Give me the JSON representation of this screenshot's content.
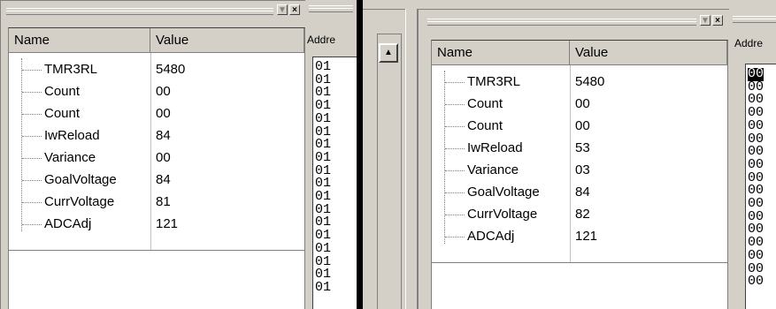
{
  "left": {
    "columns": {
      "name": "Name",
      "value": "Value"
    },
    "rows": [
      {
        "name": "TMR3RL",
        "value": "5480"
      },
      {
        "name": "Count",
        "value": "00"
      },
      {
        "name": "Count",
        "value": "00"
      },
      {
        "name": "IwReload",
        "value": "84"
      },
      {
        "name": "Variance",
        "value": "00"
      },
      {
        "name": "GoalVoltage",
        "value": "84"
      },
      {
        "name": "CurrVoltage",
        "value": "81"
      },
      {
        "name": "ADCAdj",
        "value": "121"
      }
    ],
    "address_header": "Addre",
    "address_lines": [
      "01",
      "01",
      "01",
      "01",
      "01",
      "01",
      "01",
      "01",
      "01",
      "01",
      "01",
      "01",
      "01",
      "01",
      "01",
      "01",
      "01",
      "01"
    ]
  },
  "right": {
    "columns": {
      "name": "Name",
      "value": "Value"
    },
    "rows": [
      {
        "name": "TMR3RL",
        "value": "5480"
      },
      {
        "name": "Count",
        "value": "00"
      },
      {
        "name": "Count",
        "value": "00"
      },
      {
        "name": "IwReload",
        "value": "53"
      },
      {
        "name": "Variance",
        "value": "03"
      },
      {
        "name": "GoalVoltage",
        "value": "84"
      },
      {
        "name": "CurrVoltage",
        "value": "82"
      },
      {
        "name": "ADCAdj",
        "value": "121"
      }
    ],
    "address_header": "Addre",
    "address_selected": "00",
    "address_lines": [
      "00",
      "00",
      "00",
      "00",
      "00",
      "00",
      "00",
      "00",
      "00",
      "00",
      "00",
      "00",
      "00",
      "00",
      "00",
      "00"
    ]
  },
  "titlebar": {
    "dropdown_glyph": "▼",
    "close_glyph": "×"
  },
  "scroll_up_glyph": "▲"
}
